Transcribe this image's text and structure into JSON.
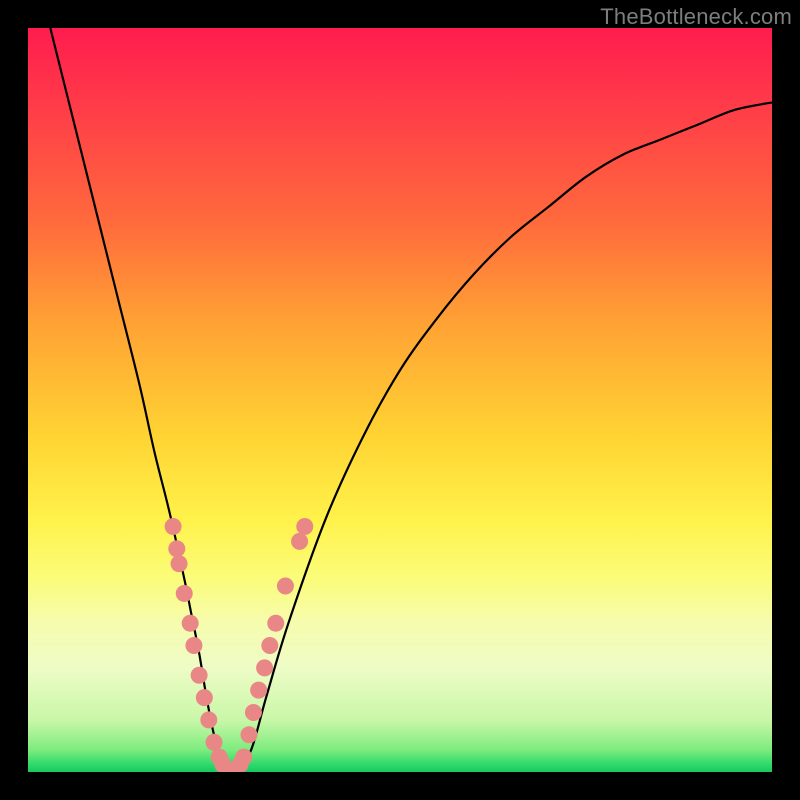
{
  "watermark": "TheBottleneck.com",
  "chart_data": {
    "type": "line",
    "title": "",
    "xlabel": "",
    "ylabel": "",
    "xlim": [
      0,
      100
    ],
    "ylim": [
      0,
      100
    ],
    "grid": false,
    "annotations": [],
    "series": [
      {
        "name": "bottleneck-curve",
        "x": [
          3,
          6,
          9,
          12,
          15,
          17,
          19,
          21,
          22,
          23,
          24,
          25,
          26,
          27,
          28,
          30,
          32,
          35,
          40,
          45,
          50,
          55,
          60,
          65,
          70,
          75,
          80,
          85,
          90,
          95,
          100
        ],
        "y": [
          100,
          88,
          76,
          64,
          52,
          43,
          35,
          26,
          21,
          16,
          10,
          5,
          2,
          0,
          0,
          3,
          10,
          20,
          34,
          45,
          54,
          61,
          67,
          72,
          76,
          80,
          83,
          85,
          87,
          89,
          90
        ]
      }
    ],
    "markers": {
      "name": "sample-points",
      "color": "#e98787",
      "points": [
        {
          "x": 19.5,
          "y": 33
        },
        {
          "x": 20.0,
          "y": 30
        },
        {
          "x": 20.3,
          "y": 28
        },
        {
          "x": 21.0,
          "y": 24
        },
        {
          "x": 21.8,
          "y": 20
        },
        {
          "x": 22.3,
          "y": 17
        },
        {
          "x": 23.0,
          "y": 13
        },
        {
          "x": 23.7,
          "y": 10
        },
        {
          "x": 24.3,
          "y": 7
        },
        {
          "x": 25.0,
          "y": 4
        },
        {
          "x": 25.7,
          "y": 2
        },
        {
          "x": 26.2,
          "y": 1
        },
        {
          "x": 27.0,
          "y": 0
        },
        {
          "x": 27.8,
          "y": 0
        },
        {
          "x": 28.5,
          "y": 1
        },
        {
          "x": 29.0,
          "y": 2
        },
        {
          "x": 29.7,
          "y": 5
        },
        {
          "x": 30.3,
          "y": 8
        },
        {
          "x": 31.0,
          "y": 11
        },
        {
          "x": 31.8,
          "y": 14
        },
        {
          "x": 32.5,
          "y": 17
        },
        {
          "x": 33.3,
          "y": 20
        },
        {
          "x": 34.6,
          "y": 25
        },
        {
          "x": 36.5,
          "y": 31
        },
        {
          "x": 37.2,
          "y": 33
        }
      ]
    },
    "background_gradient": {
      "stops": [
        {
          "pos": 0.0,
          "color": "#ff1c4e"
        },
        {
          "pos": 0.4,
          "color": "#ffa334"
        },
        {
          "pos": 0.66,
          "color": "#fff24a"
        },
        {
          "pos": 0.86,
          "color": "#eefcc6"
        },
        {
          "pos": 1.0,
          "color": "#17c95e"
        }
      ]
    }
  }
}
